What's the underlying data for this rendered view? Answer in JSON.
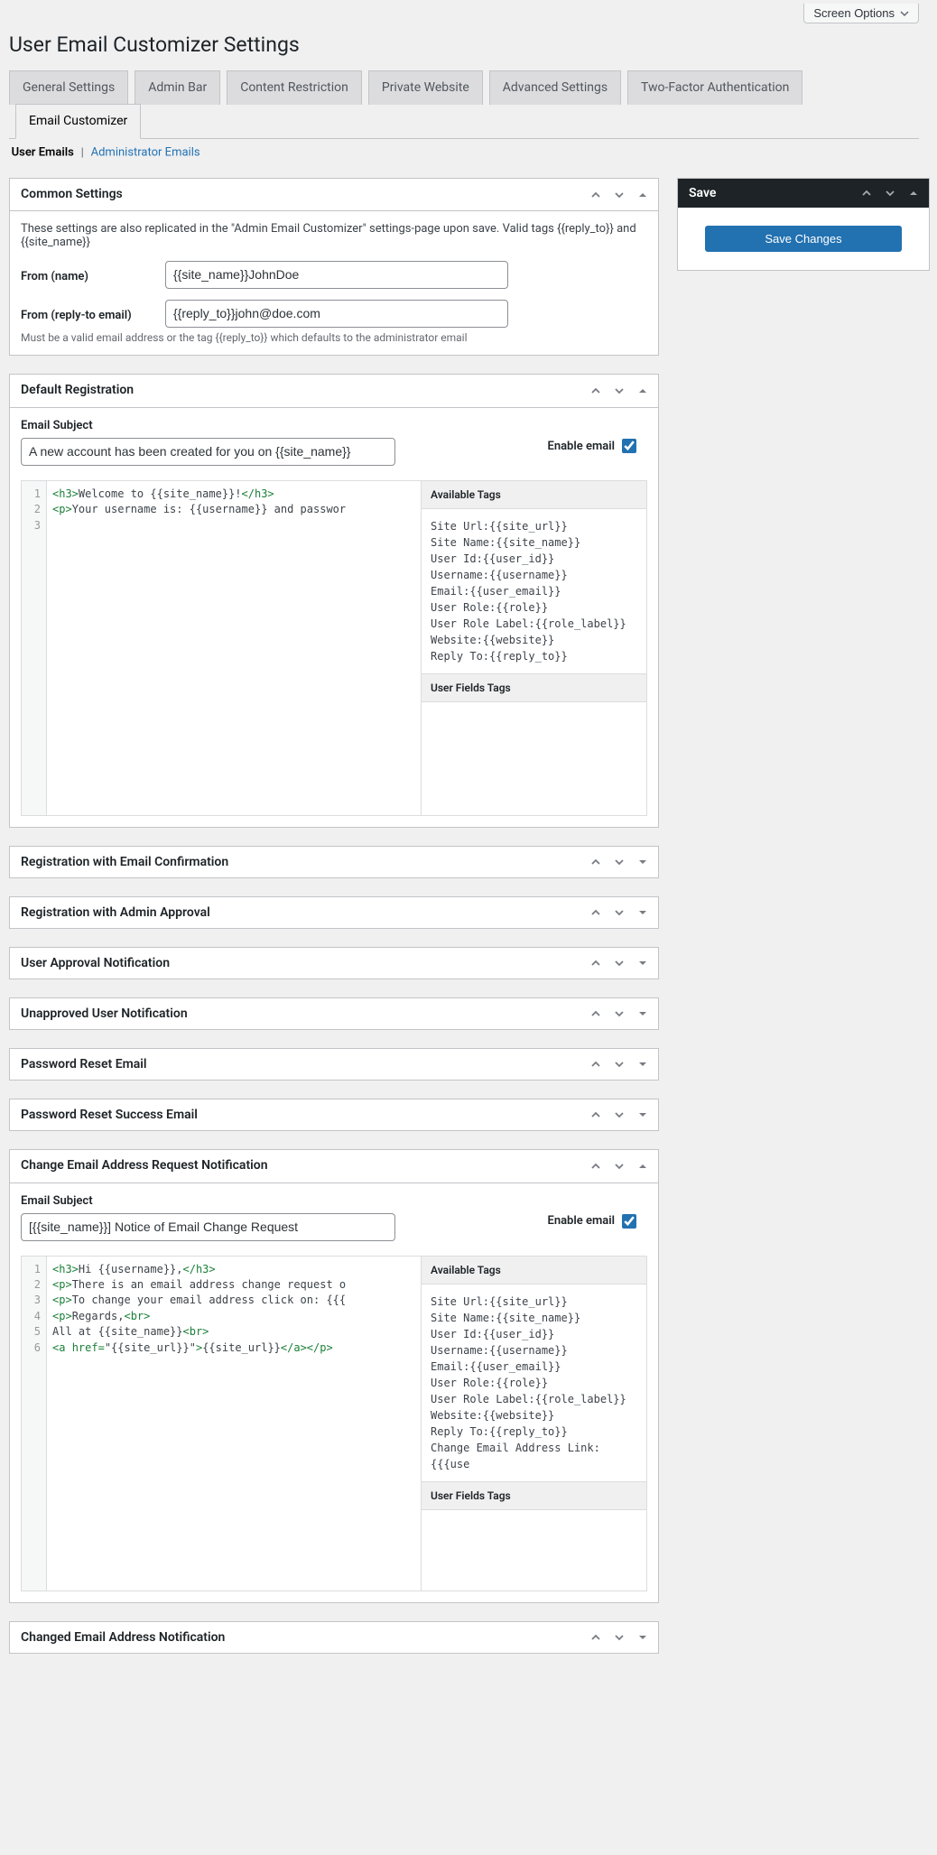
{
  "screen_options": {
    "label": "Screen Options"
  },
  "page_title": "User Email Customizer Settings",
  "tabs": [
    {
      "label": "General Settings",
      "active": false
    },
    {
      "label": "Admin Bar",
      "active": false
    },
    {
      "label": "Content Restriction",
      "active": false
    },
    {
      "label": "Private Website",
      "active": false
    },
    {
      "label": "Advanced Settings",
      "active": false
    },
    {
      "label": "Two-Factor Authentication",
      "active": false
    },
    {
      "label": "Email Customizer",
      "active": true
    }
  ],
  "sub_tabs": {
    "user": "User Emails",
    "admin": "Administrator Emails"
  },
  "save_panel": {
    "header": "Save",
    "button": "Save Changes"
  },
  "common": {
    "title": "Common Settings",
    "intro": "These settings are also replicated in the \"Admin Email Customizer\" settings-page upon save. Valid tags {{reply_to}} and {{site_name}}",
    "from_name_label": "From (name)",
    "from_name_value": "{{site_name}}JohnDoe",
    "reply_to_label": "From (reply-to email)",
    "reply_to_value": "{{reply_to}}john@doe.com",
    "reply_to_desc": "Must be a valid email address or the tag {{reply_to}} which defaults to the administrator email"
  },
  "default_reg": {
    "title": "Default Registration",
    "subject_label": "Email Subject",
    "subject_value": "A new account has been created for you on {{site_name}}",
    "enable_label": "Enable email",
    "code_html": "<span class='tag'>&lt;h3&gt;</span>Welcome to {{site_name}}!<span class='tag'>&lt;/h3&gt;</span>\n<span class='tag'>&lt;p&gt;</span>Your username is: {{username}} and passwor",
    "tags_header": "Available Tags",
    "tags_body": "Site Url:{{site_url}}\nSite Name:{{site_name}}\nUser Id:{{user_id}}\nUsername:{{username}}\nEmail:{{user_email}}\nUser Role:{{role}}\nUser Role Label:{{role_label}}\nWebsite:{{website}}\nReply To:{{reply_to}}",
    "user_fields_header": "User Fields Tags"
  },
  "collapsed_sections": [
    {
      "title": "Registration with Email Confirmation"
    },
    {
      "title": "Registration with Admin Approval"
    },
    {
      "title": "User Approval Notification"
    },
    {
      "title": "Unapproved User Notification"
    },
    {
      "title": "Password Reset Email"
    },
    {
      "title": "Password Reset Success Email"
    }
  ],
  "change_email": {
    "title": "Change Email Address Request Notification",
    "subject_label": "Email Subject",
    "subject_value": "[{{site_name}}] Notice of Email Change Request",
    "enable_label": "Enable email",
    "code_html": "<span class='tag'>&lt;h3&gt;</span>Hi {{username}},<span class='tag'>&lt;/h3&gt;</span>\n<span class='tag'>&lt;p&gt;</span>There is an email address change request o\n<span class='tag'>&lt;p&gt;</span>To change your email address click on: {{{\n<span class='tag'>&lt;p&gt;</span>Regards,<span class='tag'>&lt;br&gt;</span>\nAll at {{site_name}}<span class='tag'>&lt;br&gt;</span>\n<span class='tag'>&lt;a</span> <span class='attr'>href=</span>\"{{site_url}}\"<span class='tag'>&gt;</span>{{site_url}}<span class='tag'>&lt;/a&gt;&lt;/p&gt;</span>",
    "tags_header": "Available Tags",
    "tags_body": "Site Url:{{site_url}}\nSite Name:{{site_name}}\nUser Id:{{user_id}}\nUsername:{{username}}\nEmail:{{user_email}}\nUser Role:{{role}}\nUser Role Label:{{role_label}}\nWebsite:{{website}}\nReply To:{{reply_to}}\nChange Email Address Link:{{{use",
    "user_fields_header": "User Fields Tags"
  },
  "changed_email": {
    "title": "Changed Email Address Notification"
  }
}
